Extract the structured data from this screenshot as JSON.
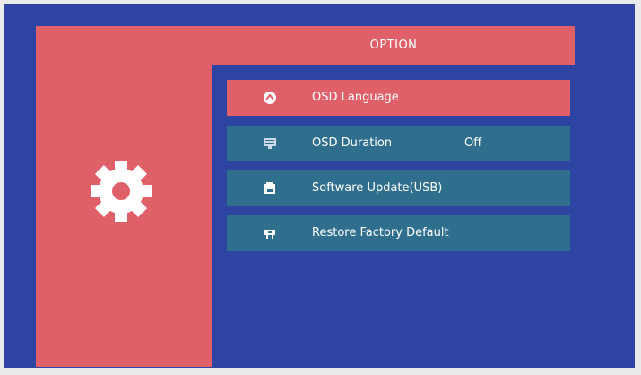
{
  "screen": {
    "title": "OPTION",
    "side_icon": "gear-icon",
    "colors": {
      "background": "#2d44a2",
      "accent": "#e0606a",
      "item": "#2f6f8d"
    }
  },
  "menu": {
    "items": [
      {
        "label": "OSD Language",
        "icon": "globe-icon",
        "value": "",
        "selected": true
      },
      {
        "label": "OSD Duration",
        "icon": "monitor-icon",
        "value": "Off",
        "selected": false
      },
      {
        "label": "Software Update(USB)",
        "icon": "usb-drive-icon",
        "value": "",
        "selected": false
      },
      {
        "label": "Restore Factory Default",
        "icon": "restore-icon",
        "value": "",
        "selected": false
      }
    ]
  }
}
